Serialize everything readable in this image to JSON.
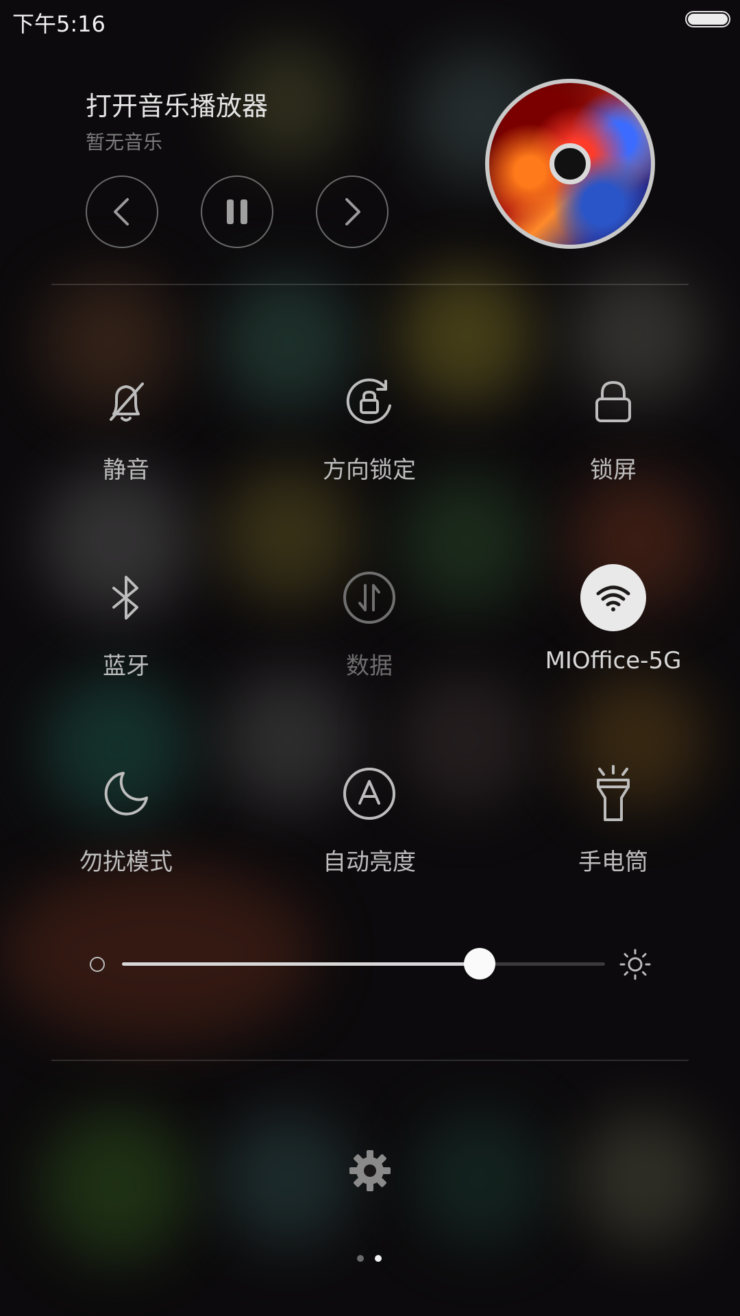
{
  "status_bar": {
    "time": "下午5:16"
  },
  "music": {
    "title": "打开音乐播放器",
    "subtitle": "暂无音乐",
    "controls": {
      "prev_icon": "chevron-left-icon",
      "pause_icon": "pause-icon",
      "next_icon": "chevron-right-icon"
    }
  },
  "toggles": [
    {
      "label": "静音",
      "icon": "bell-off-icon",
      "active": false
    },
    {
      "label": "方向锁定",
      "icon": "rotation-lock-icon",
      "active": false
    },
    {
      "label": "锁屏",
      "icon": "lock-icon",
      "active": false
    },
    {
      "label": "蓝牙",
      "icon": "bluetooth-icon",
      "active": false
    },
    {
      "label": "数据",
      "icon": "mobile-data-icon",
      "active": false,
      "disabled": true
    },
    {
      "label": "MIOffice-5G",
      "icon": "wifi-icon",
      "active": true
    },
    {
      "label": "勿扰模式",
      "icon": "moon-icon",
      "active": false
    },
    {
      "label": "自动亮度",
      "icon": "auto-brightness-icon",
      "active": false
    },
    {
      "label": "手电筒",
      "icon": "flashlight-icon",
      "active": false
    }
  ],
  "brightness": {
    "level": 0.74,
    "min_icon": "brightness-low-icon",
    "max_icon": "brightness-high-icon"
  },
  "settings": {
    "icon": "gear-icon"
  },
  "pager": {
    "pages": 2,
    "current": 2
  },
  "colors": {
    "panel_bg": "#0c0a0c",
    "active_bg": "#e9e9e9",
    "text": "#bdbdbd"
  }
}
